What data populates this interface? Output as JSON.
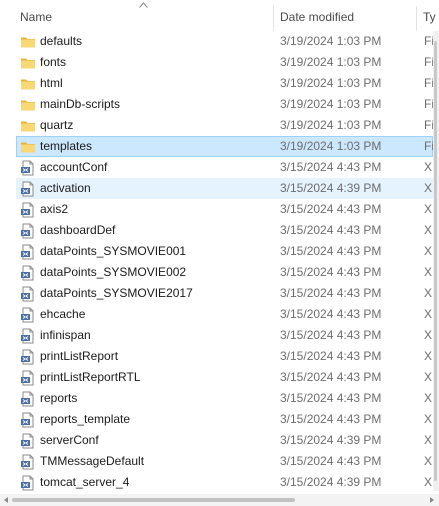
{
  "header": {
    "name": "Name",
    "date_modified": "Date modified",
    "type": "Ty"
  },
  "colors": {
    "selected_bg": "#cce8ff",
    "selected_border": "#99d1ff",
    "hover_bg": "#e5f3ff",
    "folder": "#f4c84c"
  },
  "files": [
    {
      "name": "defaults",
      "date": "3/19/2024 1:03 PM",
      "type": "Fi",
      "icon": "folder-icon"
    },
    {
      "name": "fonts",
      "date": "3/19/2024 1:03 PM",
      "type": "Fi",
      "icon": "folder-icon"
    },
    {
      "name": "html",
      "date": "3/19/2024 1:03 PM",
      "type": "Fi",
      "icon": "folder-icon"
    },
    {
      "name": "mainDb-scripts",
      "date": "3/19/2024 1:03 PM",
      "type": "Fi",
      "icon": "folder-icon"
    },
    {
      "name": "quartz",
      "date": "3/19/2024 1:03 PM",
      "type": "Fi",
      "icon": "folder-icon"
    },
    {
      "name": "templates",
      "date": "3/19/2024 1:03 PM",
      "type": "Fi",
      "icon": "folder-icon",
      "state": "selected"
    },
    {
      "name": "accountConf",
      "date": "3/15/2024 4:43 PM",
      "type": "XI",
      "icon": "xml-file-icon"
    },
    {
      "name": "activation",
      "date": "3/15/2024 4:39 PM",
      "type": "XI",
      "icon": "xml-file-icon",
      "state": "hover"
    },
    {
      "name": "axis2",
      "date": "3/15/2024 4:43 PM",
      "type": "XI",
      "icon": "xml-file-icon"
    },
    {
      "name": "dashboardDef",
      "date": "3/15/2024 4:43 PM",
      "type": "XI",
      "icon": "xml-file-icon"
    },
    {
      "name": "dataPoints_SYSMOVIE001",
      "date": "3/15/2024 4:43 PM",
      "type": "XI",
      "icon": "xml-file-icon"
    },
    {
      "name": "dataPoints_SYSMOVIE002",
      "date": "3/15/2024 4:43 PM",
      "type": "XI",
      "icon": "xml-file-icon"
    },
    {
      "name": "dataPoints_SYSMOVIE2017",
      "date": "3/15/2024 4:43 PM",
      "type": "XI",
      "icon": "xml-file-icon"
    },
    {
      "name": "ehcache",
      "date": "3/15/2024 4:43 PM",
      "type": "XI",
      "icon": "xml-file-icon"
    },
    {
      "name": "infinispan",
      "date": "3/15/2024 4:43 PM",
      "type": "XI",
      "icon": "xml-file-icon"
    },
    {
      "name": "printListReport",
      "date": "3/15/2024 4:43 PM",
      "type": "XI",
      "icon": "xml-file-icon"
    },
    {
      "name": "printListReportRTL",
      "date": "3/15/2024 4:43 PM",
      "type": "XI",
      "icon": "xml-file-icon"
    },
    {
      "name": "reports",
      "date": "3/15/2024 4:43 PM",
      "type": "XI",
      "icon": "xml-file-icon"
    },
    {
      "name": "reports_template",
      "date": "3/15/2024 4:43 PM",
      "type": "XI",
      "icon": "xml-file-icon"
    },
    {
      "name": "serverConf",
      "date": "3/15/2024 4:39 PM",
      "type": "XI",
      "icon": "xml-file-icon"
    },
    {
      "name": "TMMessageDefault",
      "date": "3/15/2024 4:43 PM",
      "type": "XI",
      "icon": "xml-file-icon"
    },
    {
      "name": "tomcat_server_4",
      "date": "3/15/2024 4:39 PM",
      "type": "XI",
      "icon": "xml-file-icon"
    }
  ]
}
